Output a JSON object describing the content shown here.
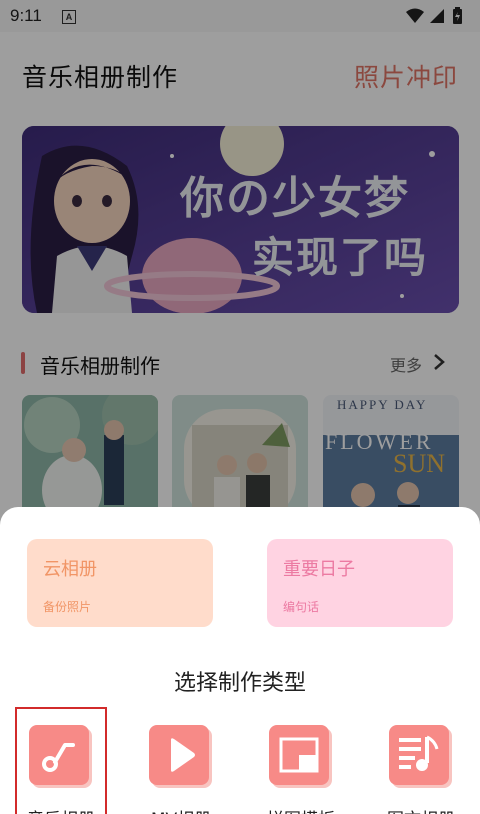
{
  "status_bar": {
    "time": "9:11",
    "notification_icon": "A"
  },
  "header": {
    "title": "音乐相册制作",
    "photo_print_link": "照片冲印"
  },
  "banner": {
    "line1": "你の少女梦",
    "line2": "实现了吗"
  },
  "section": {
    "title": "音乐相册制作",
    "more_label": "更多"
  },
  "thumbnails": [
    {
      "caption": ""
    },
    {
      "caption": ""
    },
    {
      "caption_top": "HAPPY DAY",
      "caption_mid": "FLOWER",
      "caption_sun": "SUN"
    }
  ],
  "sheet": {
    "cards": [
      {
        "title": "云相册",
        "subtitle": "备份照片",
        "bg": "#ffdccb",
        "title_color": "#f19566",
        "sub_color": "#f19566"
      },
      {
        "title": "重要日子",
        "subtitle": "编句话",
        "bg": "#ffd3e2",
        "title_color": "#ec7aa2",
        "sub_color": "#ec7aa2"
      }
    ],
    "title": "选择制作类型",
    "types": [
      {
        "label": "音乐相册",
        "icon": "music-note-icon"
      },
      {
        "label": "MV相册",
        "icon": "play-icon"
      },
      {
        "label": "拼图模板",
        "icon": "collage-icon"
      },
      {
        "label": "图文相册",
        "icon": "text-music-icon"
      }
    ]
  },
  "colors": {
    "accent": "#e07566",
    "type_icon_bg": "#f78a87",
    "highlight_border": "#d22b2b"
  }
}
